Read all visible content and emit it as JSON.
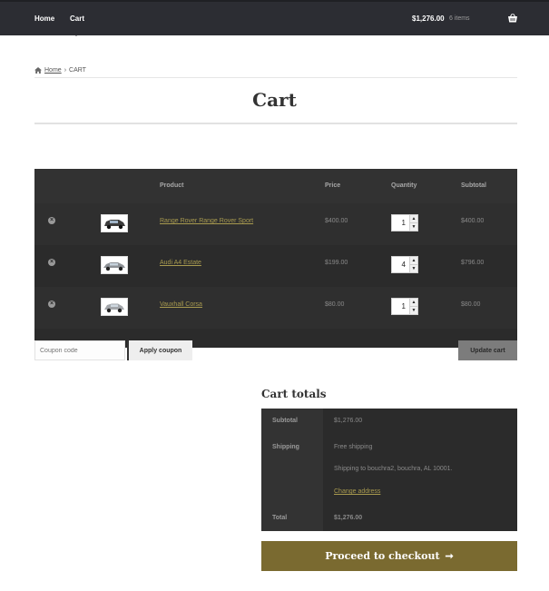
{
  "nav": {
    "home_label": "Home",
    "cart_label": "Cart"
  },
  "header_cart": {
    "total": "$1,276.00",
    "count": "6 items",
    "icon": "basket-icon"
  },
  "breadcrumb": {
    "home_label": "Home",
    "separator": "›",
    "current": "CART"
  },
  "page": {
    "title": "Cart"
  },
  "cart_table": {
    "headers": {
      "product": "Product",
      "price": "Price",
      "quantity": "Quantity",
      "subtotal": "Subtotal"
    },
    "rows": [
      {
        "name": "Range Rover Range Rover Sport",
        "price": "$400.00",
        "quantity": "1",
        "subtotal": "$400.00"
      },
      {
        "name": "Audi A4 Estate",
        "price": "$199.00",
        "quantity": "4",
        "subtotal": "$796.00"
      },
      {
        "name": "Vauxhall Corsa",
        "price": "$80.00",
        "quantity": "1",
        "subtotal": "$80.00"
      }
    ]
  },
  "actions": {
    "coupon_placeholder": "Coupon code",
    "apply_label": "Apply coupon",
    "update_label": "Update cart"
  },
  "totals": {
    "title": "Cart totals",
    "subtotal_label": "Subtotal",
    "subtotal_value": "$1,276.00",
    "shipping_label": "Shipping",
    "shipping_method": "Free shipping",
    "shipping_to": "Shipping to bouchra2, bouchra, AL 10001.",
    "change_address": "Change address",
    "total_label": "Total",
    "total_value": "$1,276.00"
  },
  "checkout": {
    "label": "Proceed to checkout",
    "arrow": "➞"
  },
  "colors": {
    "header_bg": "#2c2d33",
    "table_bg": "#2b2b2b",
    "accent_link": "#a89a4f",
    "checkout_bg": "#7a6a30"
  }
}
